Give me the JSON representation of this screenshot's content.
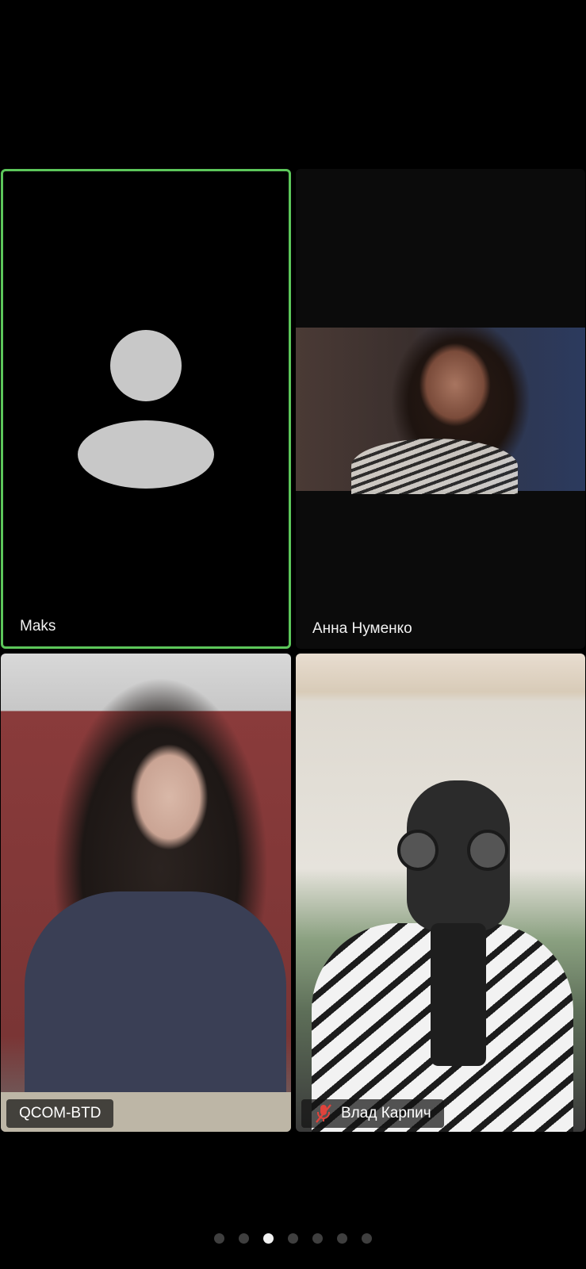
{
  "participants": [
    {
      "name": "Maks",
      "video": "off",
      "speaking": true
    },
    {
      "name": "Анна Нуменко",
      "video": "on"
    },
    {
      "name": "QCOM-BTD",
      "video": "on"
    },
    {
      "name": "Влад Карпич",
      "video": "on",
      "muted": true
    }
  ],
  "colors": {
    "active_speaker_border": "#5cc65a",
    "mute_icon": "#e0433c",
    "avatar_placeholder": "#c8c8c8"
  },
  "pager": {
    "total_pages": 7,
    "current_page": 3
  }
}
